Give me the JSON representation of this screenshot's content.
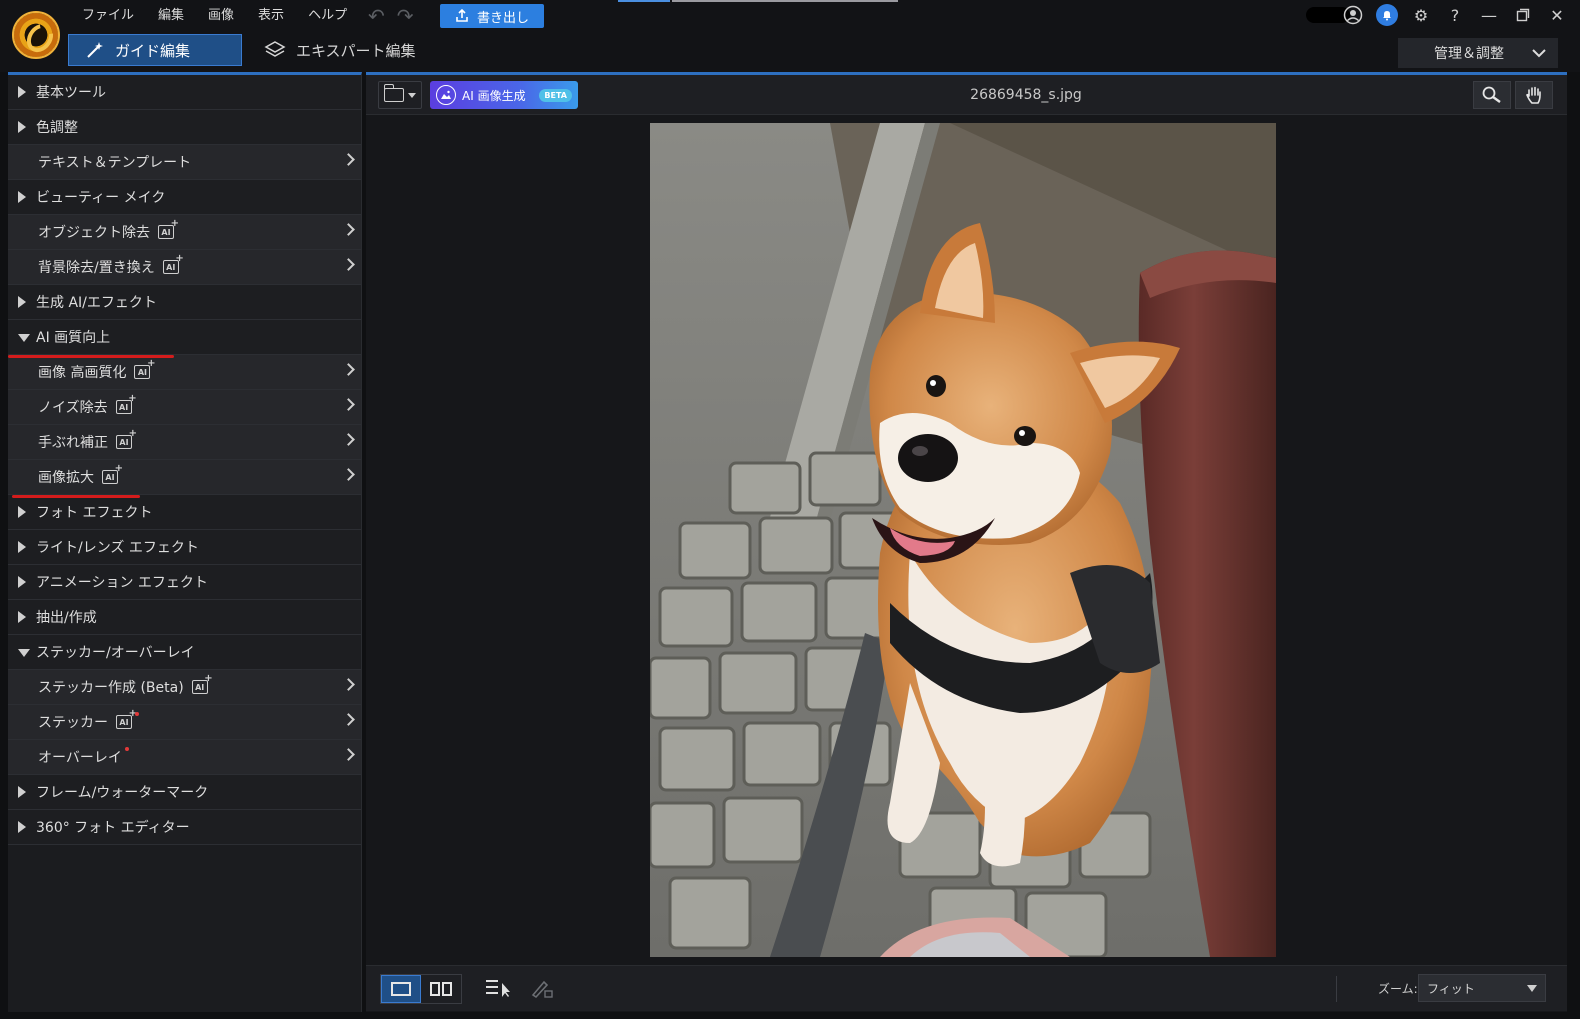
{
  "menu": [
    "ファイル",
    "編集",
    "画像",
    "表示",
    "ヘルプ"
  ],
  "toolbar": {
    "export_label": "書き出し"
  },
  "modes": {
    "guide": "ガイド編集",
    "expert": "エキスパート編集",
    "manage": "管理＆調整"
  },
  "window_icons": [
    "user-icon",
    "bell-icon",
    "gear-icon",
    "help-icon",
    "minimize-icon",
    "maximize-icon",
    "close-icon"
  ],
  "panel": {
    "items": [
      {
        "label": "基本ツール",
        "kind": "section",
        "expanded": false
      },
      {
        "label": "色調整",
        "kind": "section",
        "expanded": false
      },
      {
        "label": "テキスト＆テンプレート",
        "kind": "sub",
        "ai": false
      },
      {
        "label": "ビューティー メイク",
        "kind": "section",
        "expanded": false
      },
      {
        "label": "オブジェクト除去",
        "kind": "sub",
        "ai": true
      },
      {
        "label": "背景除去/置き換え",
        "kind": "sub",
        "ai": true
      },
      {
        "label": "生成 AI/エフェクト",
        "kind": "section",
        "expanded": false
      },
      {
        "label": "AI 画質向上",
        "kind": "section",
        "expanded": true
      },
      {
        "label": "画像 高画質化",
        "kind": "sub",
        "ai": true
      },
      {
        "label": "ノイズ除去",
        "kind": "sub",
        "ai": true
      },
      {
        "label": "手ぶれ補正",
        "kind": "sub",
        "ai": true
      },
      {
        "label": "画像拡大",
        "kind": "sub",
        "ai": true
      },
      {
        "label": "フォト エフェクト",
        "kind": "section",
        "expanded": false
      },
      {
        "label": "ライト/レンズ エフェクト",
        "kind": "section",
        "expanded": false
      },
      {
        "label": "アニメーション エフェクト",
        "kind": "section",
        "expanded": false
      },
      {
        "label": "抽出/作成",
        "kind": "section",
        "expanded": false
      },
      {
        "label": "ステッカー/オーバーレイ",
        "kind": "section",
        "expanded": true
      },
      {
        "label": "ステッカー作成 (Beta)",
        "kind": "sub",
        "ai": true
      },
      {
        "label": "ステッカー",
        "kind": "sub",
        "ai": true,
        "new": true
      },
      {
        "label": "オーバーレイ",
        "kind": "sub",
        "ai": false,
        "new": true
      },
      {
        "label": "フレーム/ウォーターマーク",
        "kind": "section",
        "expanded": false
      },
      {
        "label": "360° フォト エディター",
        "kind": "section",
        "expanded": false
      }
    ]
  },
  "canvas": {
    "ai_gen_label": "AI 画像生成",
    "beta_label": "BETA",
    "filename": "26869458_s.jpg",
    "tools": [
      "search-icon",
      "hand-icon"
    ]
  },
  "bottom": {
    "zoom_label": "ズーム:",
    "zoom_value": "フィット"
  },
  "colors": {
    "accent": "#2c7fe0",
    "underline": "#d41c1c",
    "panel_bg": "#1b1c1f"
  }
}
